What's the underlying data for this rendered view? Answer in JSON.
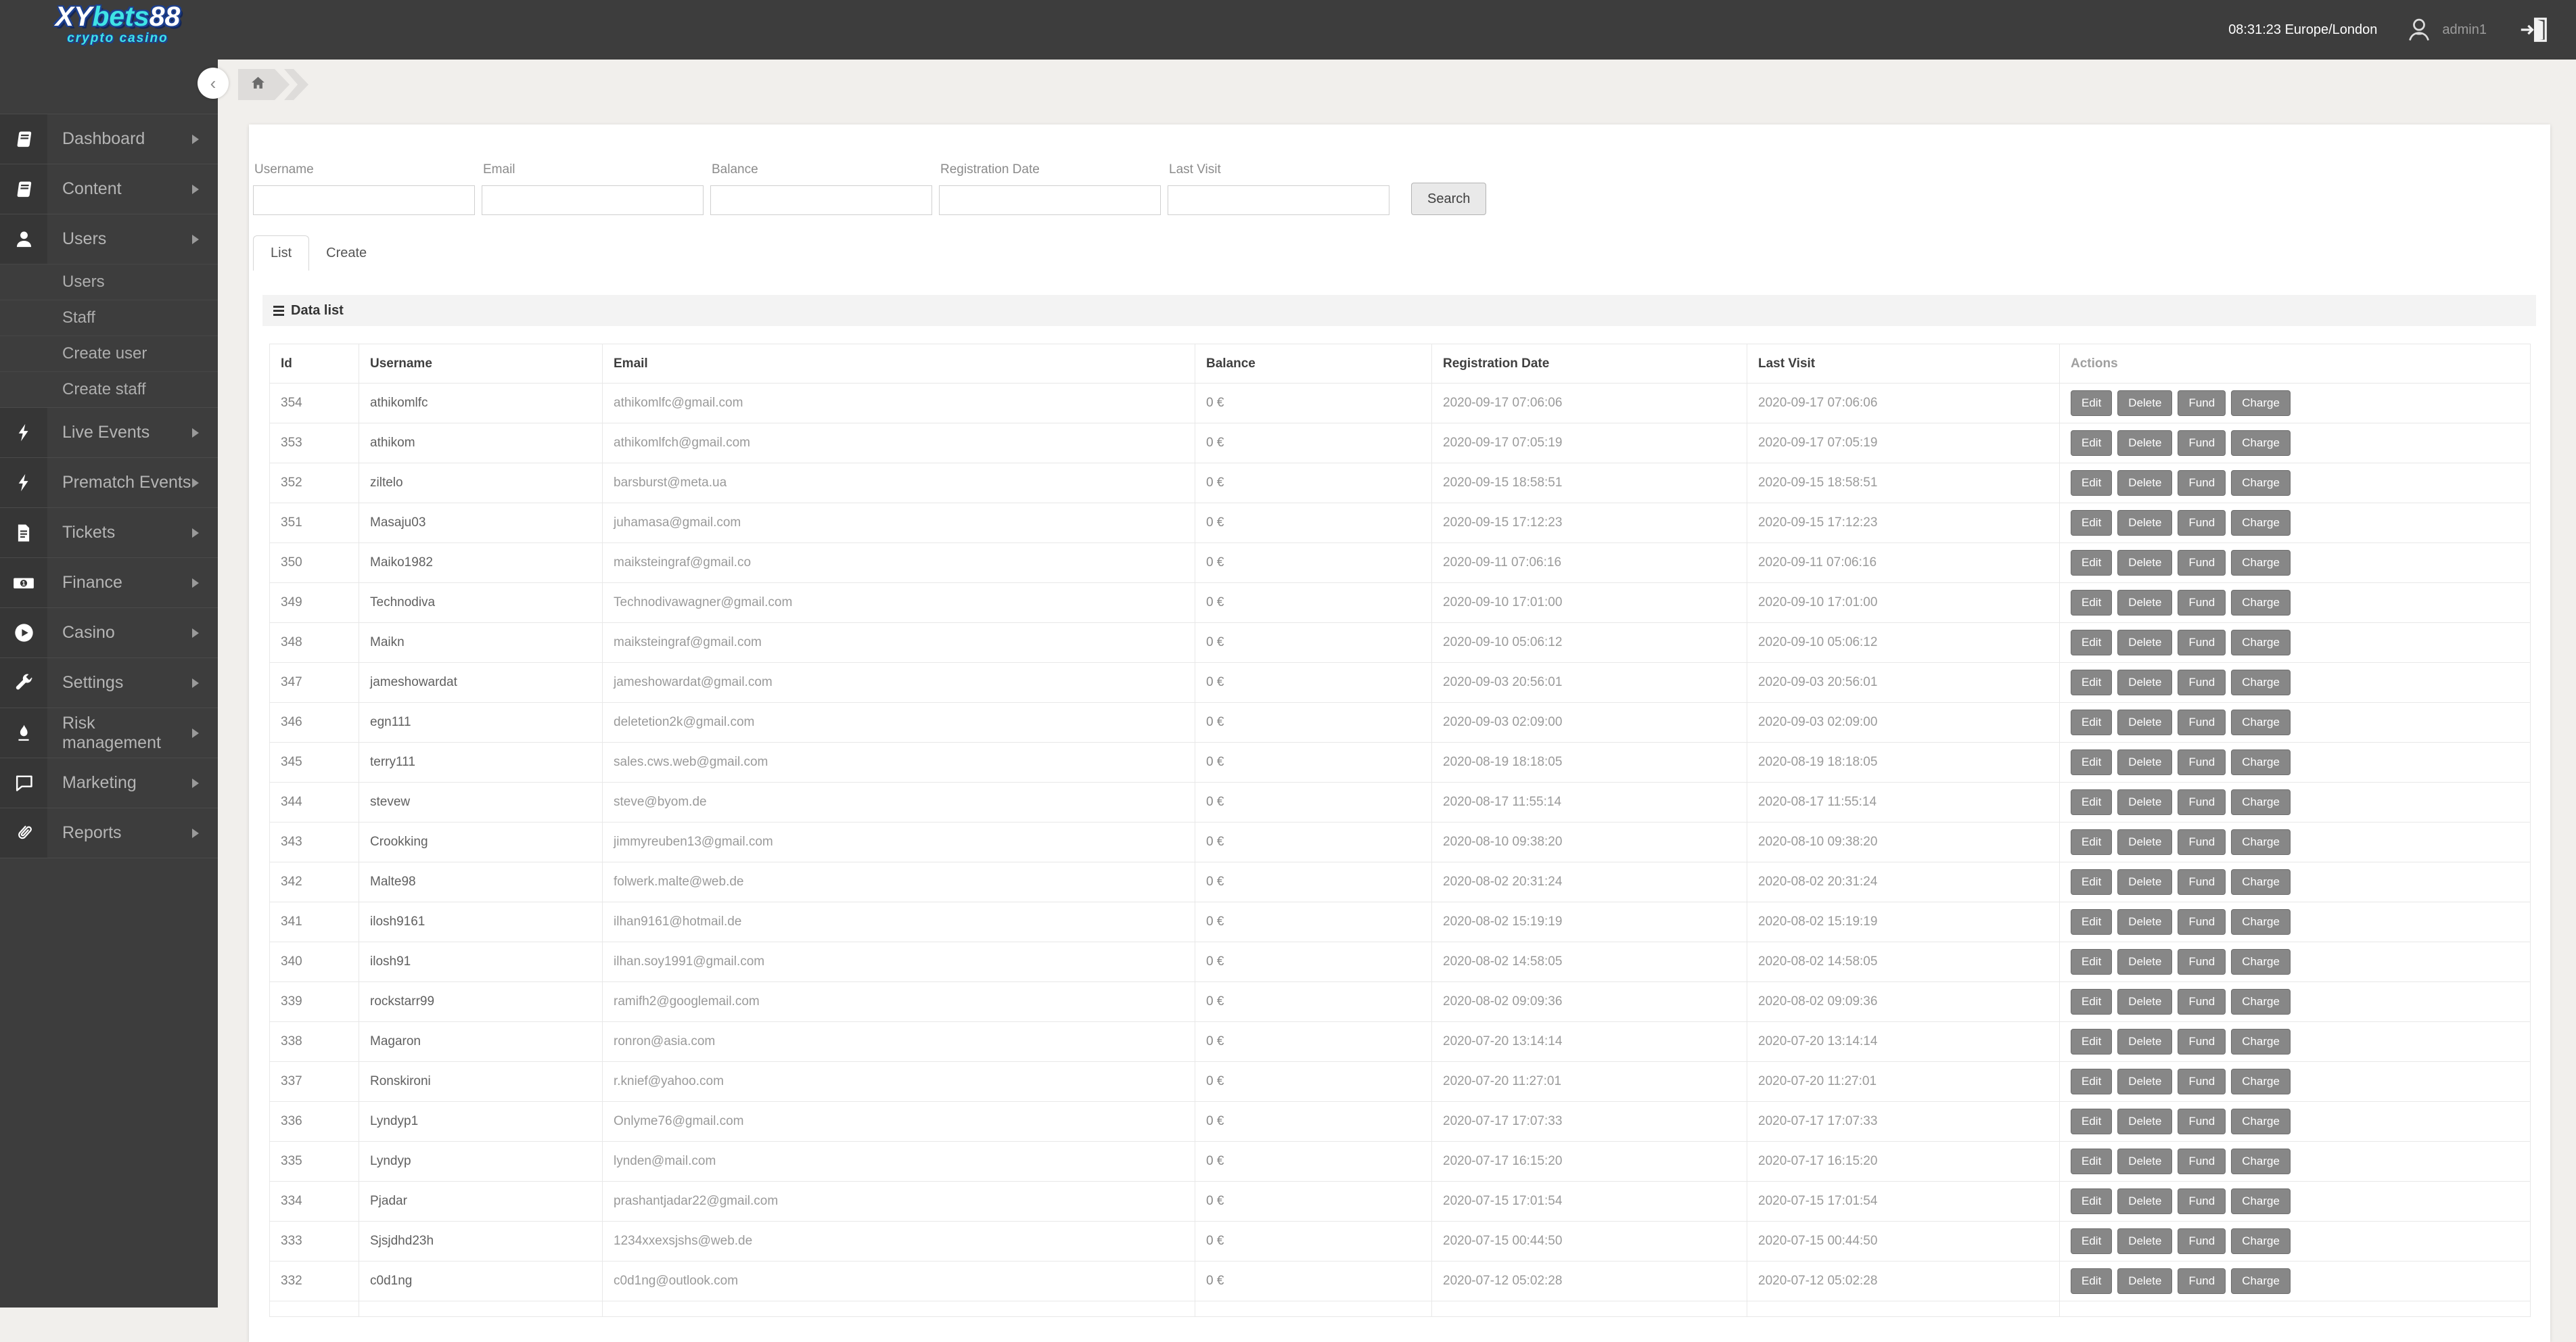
{
  "colors": {
    "cyan": "#3fe3e6",
    "navy": "#1c3f8e",
    "action_button": "#878787"
  },
  "logo": {
    "part1": "XY",
    "part2": "bets",
    "part3": "88",
    "tagline": "crypto casino"
  },
  "topbar": {
    "clock": "08:31:23 Europe/London",
    "username": "admin1"
  },
  "breadcrumb": {
    "home_icon": "home-icon"
  },
  "sidebar": {
    "items": [
      {
        "label": "Dashboard",
        "icon": "book-icon",
        "type": "top"
      },
      {
        "label": "Content",
        "icon": "book-icon",
        "type": "top"
      },
      {
        "label": "Users",
        "icon": "user-icon",
        "type": "top"
      },
      {
        "label": "Users",
        "type": "sub"
      },
      {
        "label": "Staff",
        "type": "sub"
      },
      {
        "label": "Create user",
        "type": "sub"
      },
      {
        "label": "Create staff",
        "type": "sub"
      },
      {
        "label": "Live Events",
        "icon": "lightning-icon",
        "type": "top"
      },
      {
        "label": "Prematch Events",
        "icon": "lightning-icon",
        "type": "top"
      },
      {
        "label": "Tickets",
        "icon": "document-icon",
        "type": "top"
      },
      {
        "label": "Finance",
        "icon": "banknote-icon",
        "type": "top"
      },
      {
        "label": "Casino",
        "icon": "play-icon",
        "type": "top"
      },
      {
        "label": "Settings",
        "icon": "wrench-icon",
        "type": "top"
      },
      {
        "label": "Risk management",
        "icon": "flame-icon",
        "type": "top"
      },
      {
        "label": "Marketing",
        "icon": "chat-icon",
        "type": "top"
      },
      {
        "label": "Reports",
        "icon": "paperclip-icon",
        "type": "top"
      }
    ]
  },
  "search": {
    "fields": [
      "Username",
      "Email",
      "Balance",
      "Registration Date",
      "Last Visit"
    ],
    "values": [
      "",
      "",
      "",
      "",
      ""
    ],
    "button": "Search"
  },
  "tabs": {
    "list": "List",
    "create": "Create"
  },
  "panel": {
    "title": "Data list"
  },
  "table": {
    "headers": [
      "Id",
      "Username",
      "Email",
      "Balance",
      "Registration Date",
      "Last Visit",
      "Actions"
    ],
    "actions": [
      "Edit",
      "Delete",
      "Fund",
      "Charge"
    ],
    "rows": [
      {
        "id": 354,
        "username": "athikomlfc",
        "email": "athikomlfc@gmail.com",
        "balance": "0 €",
        "registration_date": "2020-09-17 07:06:06",
        "last_visit": "2020-09-17 07:06:06"
      },
      {
        "id": 353,
        "username": "athikom",
        "email": "athikomlfch@gmail.com",
        "balance": "0 €",
        "registration_date": "2020-09-17 07:05:19",
        "last_visit": "2020-09-17 07:05:19"
      },
      {
        "id": 352,
        "username": "ziltelo",
        "email": "barsburst@meta.ua",
        "balance": "0 €",
        "registration_date": "2020-09-15 18:58:51",
        "last_visit": "2020-09-15 18:58:51"
      },
      {
        "id": 351,
        "username": "Masaju03",
        "email": "juhamasa@gmail.com",
        "balance": "0 €",
        "registration_date": "2020-09-15 17:12:23",
        "last_visit": "2020-09-15 17:12:23"
      },
      {
        "id": 350,
        "username": "Maiko1982",
        "email": "maiksteingraf@gmail.co",
        "balance": "0 €",
        "registration_date": "2020-09-11 07:06:16",
        "last_visit": "2020-09-11 07:06:16"
      },
      {
        "id": 349,
        "username": "Technodiva",
        "email": "Technodivawagner@gmail.com",
        "balance": "0 €",
        "registration_date": "2020-09-10 17:01:00",
        "last_visit": "2020-09-10 17:01:00"
      },
      {
        "id": 348,
        "username": "Maikn",
        "email": "maiksteingraf@gmail.com",
        "balance": "0 €",
        "registration_date": "2020-09-10 05:06:12",
        "last_visit": "2020-09-10 05:06:12"
      },
      {
        "id": 347,
        "username": "jameshowardat",
        "email": "jameshowardat@gmail.com",
        "balance": "0 €",
        "registration_date": "2020-09-03 20:56:01",
        "last_visit": "2020-09-03 20:56:01"
      },
      {
        "id": 346,
        "username": "egn111",
        "email": "deletetion2k@gmail.com",
        "balance": "0 €",
        "registration_date": "2020-09-03 02:09:00",
        "last_visit": "2020-09-03 02:09:00"
      },
      {
        "id": 345,
        "username": "terry111",
        "email": "sales.cws.web@gmail.com",
        "balance": "0 €",
        "registration_date": "2020-08-19 18:18:05",
        "last_visit": "2020-08-19 18:18:05"
      },
      {
        "id": 344,
        "username": "stevew",
        "email": "steve@byom.de",
        "balance": "0 €",
        "registration_date": "2020-08-17 11:55:14",
        "last_visit": "2020-08-17 11:55:14"
      },
      {
        "id": 343,
        "username": "Crookking",
        "email": "jimmyreuben13@gmail.com",
        "balance": "0 €",
        "registration_date": "2020-08-10 09:38:20",
        "last_visit": "2020-08-10 09:38:20"
      },
      {
        "id": 342,
        "username": "Malte98",
        "email": "folwerk.malte@web.de",
        "balance": "0 €",
        "registration_date": "2020-08-02 20:31:24",
        "last_visit": "2020-08-02 20:31:24"
      },
      {
        "id": 341,
        "username": "ilosh9161",
        "email": "ilhan9161@hotmail.de",
        "balance": "0 €",
        "registration_date": "2020-08-02 15:19:19",
        "last_visit": "2020-08-02 15:19:19"
      },
      {
        "id": 340,
        "username": "ilosh91",
        "email": "ilhan.soy1991@gmail.com",
        "balance": "0 €",
        "registration_date": "2020-08-02 14:58:05",
        "last_visit": "2020-08-02 14:58:05"
      },
      {
        "id": 339,
        "username": "rockstarr99",
        "email": "ramifh2@googlemail.com",
        "balance": "0 €",
        "registration_date": "2020-08-02 09:09:36",
        "last_visit": "2020-08-02 09:09:36"
      },
      {
        "id": 338,
        "username": "Magaron",
        "email": "ronron@asia.com",
        "balance": "0 €",
        "registration_date": "2020-07-20 13:14:14",
        "last_visit": "2020-07-20 13:14:14"
      },
      {
        "id": 337,
        "username": "Ronskironi",
        "email": "r.knief@yahoo.com",
        "balance": "0 €",
        "registration_date": "2020-07-20 11:27:01",
        "last_visit": "2020-07-20 11:27:01"
      },
      {
        "id": 336,
        "username": "Lyndyp1",
        "email": "Onlyme76@gmail.com",
        "balance": "0 €",
        "registration_date": "2020-07-17 17:07:33",
        "last_visit": "2020-07-17 17:07:33"
      },
      {
        "id": 335,
        "username": "Lyndyp",
        "email": "lynden@mail.com",
        "balance": "0 €",
        "registration_date": "2020-07-17 16:15:20",
        "last_visit": "2020-07-17 16:15:20"
      },
      {
        "id": 334,
        "username": "Pjadar",
        "email": "prashantjadar22@gmail.com",
        "balance": "0 €",
        "registration_date": "2020-07-15 17:01:54",
        "last_visit": "2020-07-15 17:01:54"
      },
      {
        "id": 333,
        "username": "Sjsjdhd23h",
        "email": "1234xxexsjshs@web.de",
        "balance": "0 €",
        "registration_date": "2020-07-15 00:44:50",
        "last_visit": "2020-07-15 00:44:50"
      },
      {
        "id": 332,
        "username": "c0d1ng",
        "email": "c0d1ng@outlook.com",
        "balance": "0 €",
        "registration_date": "2020-07-12 05:02:28",
        "last_visit": "2020-07-12 05:02:28"
      }
    ]
  }
}
